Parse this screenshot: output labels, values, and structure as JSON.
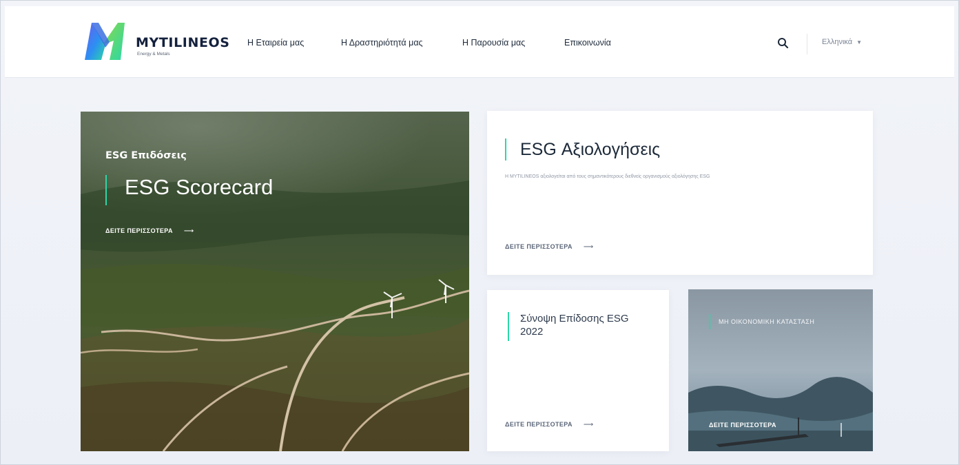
{
  "brand": {
    "name": "MYTILINEOS",
    "tagline": "Energy & Metals"
  },
  "nav": {
    "items": [
      {
        "label": "Η Εταιρεία μας"
      },
      {
        "label": "Η Δραστηριότητά μας"
      },
      {
        "label": "Η Παρουσία μας"
      },
      {
        "label": "Επικοινωνία"
      }
    ],
    "language": "Ελληνικά"
  },
  "icons": {
    "search": "search-icon",
    "arrow": "arrow-right-icon"
  },
  "colors": {
    "accent": "#2bd7a6",
    "header_bg": "#ffffff",
    "page_bg": "#eef0f6"
  },
  "cards": {
    "scorecard": {
      "eyebrow": "ESG Επιδόσεις",
      "title": "ESG Scorecard",
      "more": "ΔΕΙΤΕ ΠΕΡΙΣΣΟΤΕΡΑ",
      "arrow": "⟶"
    },
    "ratings": {
      "title": "ESG Αξιολογήσεις",
      "description": "Η MYTILINEOS αξιολογείται από τους σημαντικότερους διεθνείς οργανισμούς αξιολόγησης ESG",
      "more": "ΔΕΙΤΕ ΠΕΡΙΣΣΟΤΕΡΑ",
      "arrow": "⟶"
    },
    "summary": {
      "title": "Σύνοψη Επίδοσης ESG 2022",
      "more": "ΔΕΙΤΕ ΠΕΡΙΣΣΟΤΕΡΑ",
      "arrow": "⟶"
    },
    "photo": {
      "title": "ΜΗ ΟΙΚΟΝΟΜΙΚΗ ΚΑΤΑΣΤΑΣΗ",
      "more": "ΔΕΙΤΕ ΠΕΡΙΣΣΟΤΕΡΑ"
    }
  }
}
